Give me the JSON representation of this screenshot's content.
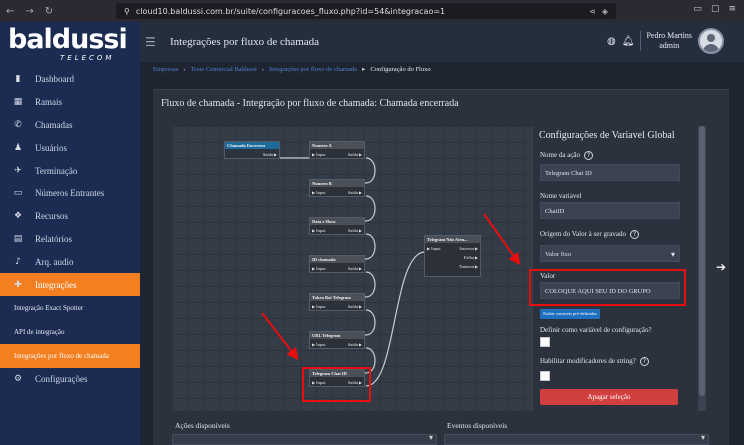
{
  "browser": {
    "url": "cloud10.baldussi.com.br/suite/configuracoes_fluxo.php?id=54&integracao=1"
  },
  "brand": {
    "name": "baldussi",
    "tagline": "TELECOM"
  },
  "sidebar": {
    "items": [
      {
        "label": "Dashboard",
        "icon": "chart-icon"
      },
      {
        "label": "Ramais",
        "icon": "grid-icon"
      },
      {
        "label": "Chamadas",
        "icon": "phone-icon"
      },
      {
        "label": "Usuários",
        "icon": "user-icon"
      },
      {
        "label": "Terminação",
        "icon": "phone-transfer-icon"
      },
      {
        "label": "Números Entrantes",
        "icon": "numbers-icon"
      },
      {
        "label": "Recursos",
        "icon": "cubes-icon"
      },
      {
        "label": "Relatórios",
        "icon": "clipboard-icon"
      },
      {
        "label": "Arq. audio",
        "icon": "audio-icon"
      },
      {
        "label": "Integrações",
        "icon": "puzzle-icon"
      }
    ],
    "subitems": [
      {
        "label": "Integração Exact Spotter"
      },
      {
        "label": "API de integração"
      },
      {
        "label": "Integrações por fluxo de chamada"
      }
    ],
    "settings": {
      "label": "Configurações",
      "icon": "gear-icon"
    }
  },
  "topbar": {
    "title": "Integrações por fluxo de chamada",
    "user_name": "Pedro Martins",
    "user_role": "admin"
  },
  "breadcrumb": {
    "items": [
      "Empresas",
      "Teste Comercial Baldussi",
      "Integrações por fluxo de chamada"
    ],
    "current": "Configuração do Fluxo"
  },
  "panel": {
    "title": "Fluxo de chamada - Integração por fluxo de chamada: Chamada encerrada"
  },
  "flow": {
    "start": {
      "title": "Chamada Encerrou",
      "output": "Saída"
    },
    "nodes": [
      {
        "title": "Numero A",
        "input": "Input",
        "output": "Saída"
      },
      {
        "title": "Numero B",
        "input": "Input",
        "output": "Saída"
      },
      {
        "title": "Data e Hora",
        "input": "Input",
        "output": "Saída"
      },
      {
        "title": "ID chamada",
        "input": "Input",
        "output": "Saída"
      },
      {
        "title": "Token Bot Telegram",
        "input": "Input",
        "output": "Saída"
      },
      {
        "title": "URL Telegram",
        "input": "Input",
        "output": "Saída"
      },
      {
        "title": "Telegram Chat ID",
        "input": "Input",
        "output": "Saída"
      }
    ],
    "telegram": {
      "title": "Telegram Não Aten...",
      "input": "Input",
      "outputs": [
        "Sucesso",
        "Falha",
        "Timeout"
      ]
    }
  },
  "config": {
    "heading": "Configurações de Variavel Global",
    "action_name_label": "Nome da ação",
    "action_name_value": "Telegram Chat ID",
    "variable_name_label": "Nome variavel",
    "variable_name_value": "ChatID",
    "origin_label": "Origem do Valor à ser gravado",
    "origin_value": "Valor fixo",
    "value_label": "Valor",
    "value_value": "COLOQUE AQUI SEU ID DO GRUPO",
    "show_vars_button": "Exibir variaveis pré-definidas",
    "config_var_label": "Definir como variável de configuração?",
    "string_mod_label": "Habilitar modificadores de string?",
    "delete_button": "Apagar seleção"
  },
  "bottom": {
    "actions_label": "Ações disponíveis",
    "events_label": "Eventos disponíveis"
  },
  "colors": {
    "sidebar": "#1b2b52",
    "accent": "#f47f20",
    "danger": "#d13f3f",
    "highlight": "#e60e0e"
  }
}
